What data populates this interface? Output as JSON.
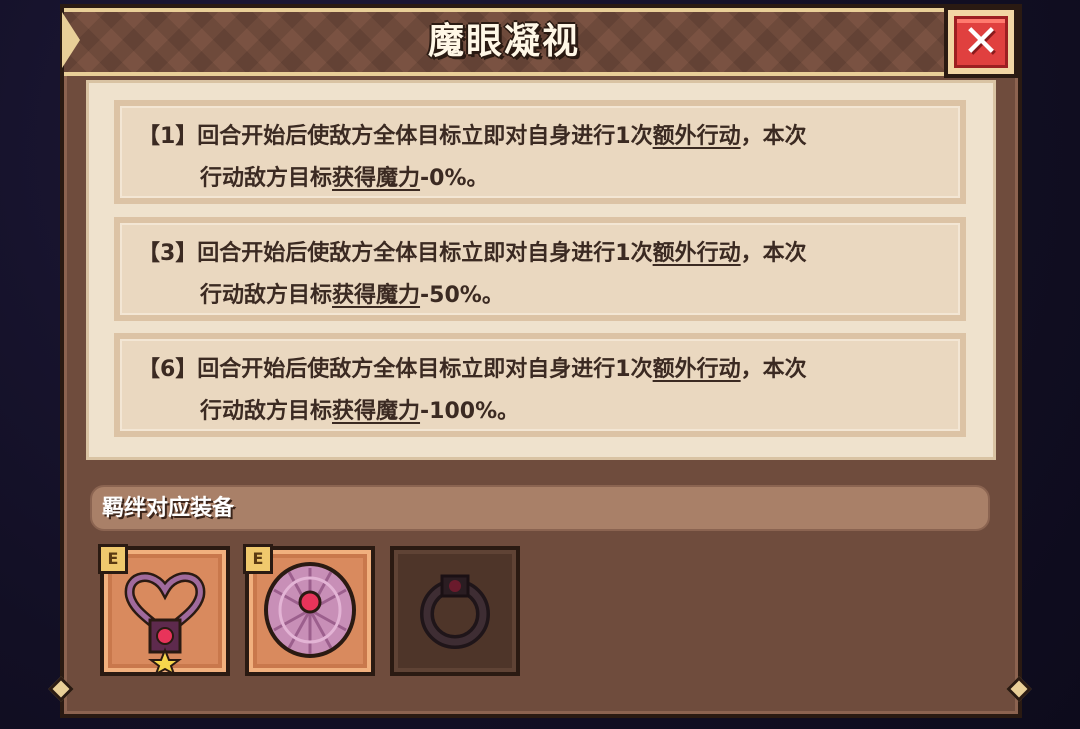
{
  "window": {
    "title": "魔眼凝视",
    "close_icon": "close-icon",
    "close_glyph": "✕"
  },
  "skills": [
    {
      "prefix": "【1】回合开始后使敌方全体目标立即对自身进行1次",
      "link1": "额外行动",
      "mid": "，本次",
      "line2_start": "行动敌方目标",
      "link2": "获得魔力",
      "suffix": "-0%。"
    },
    {
      "prefix": "【3】回合开始后使敌方全体目标立即对自身进行1次",
      "link1": "额外行动",
      "mid": "，本次",
      "line2_start": "行动敌方目标",
      "link2": "获得魔力",
      "suffix": "-50%。"
    },
    {
      "prefix": "【6】回合开始后使敌方全体目标立即对自身进行1次",
      "link1": "额外行动",
      "mid": "，本次",
      "line2_start": "行动敌方目标",
      "link2": "获得魔力",
      "suffix": "-100%。"
    }
  ],
  "equipment": {
    "label": "羁绊对应装备",
    "items": [
      {
        "icon": "heart-necklace-icon",
        "rarity": "E",
        "owned": true
      },
      {
        "icon": "shell-brooch-icon",
        "rarity": "E",
        "owned": true
      },
      {
        "icon": "dark-ring-icon",
        "rarity": "",
        "owned": false
      }
    ]
  },
  "colors": {
    "panel": "#6f4c3d",
    "header_trim": "#e9cf98",
    "close_red": "#e0403f",
    "card_bg": "#ead8c0",
    "text": "#3b2a22"
  }
}
